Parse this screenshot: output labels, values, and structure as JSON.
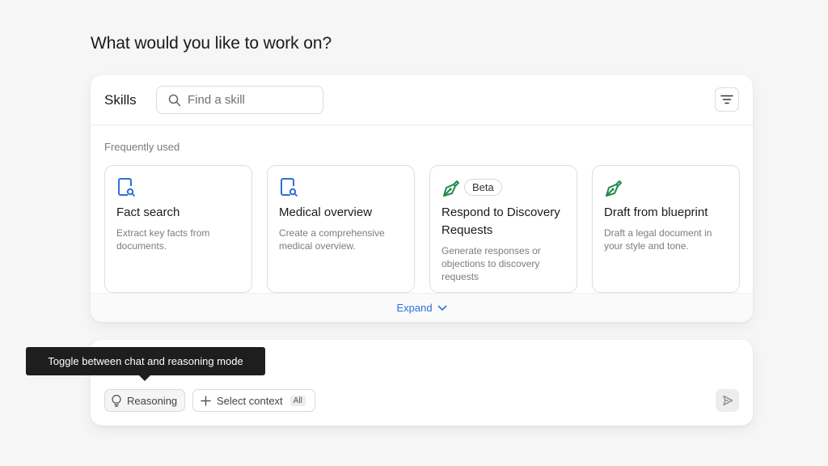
{
  "page": {
    "title": "What would you like to work on?"
  },
  "skills": {
    "title": "Skills",
    "search_placeholder": "Find a skill",
    "section_label": "Frequently used",
    "cards": [
      {
        "title": "Fact search",
        "description": "Extract key facts from documents.",
        "icon": "document-search-icon",
        "badge": ""
      },
      {
        "title": "Medical overview",
        "description": "Create a comprehensive medical overview.",
        "icon": "document-search-icon",
        "badge": ""
      },
      {
        "title": "Respond to Discovery Requests",
        "description": "Generate responses or objections to discovery requests",
        "icon": "pen-nib-icon",
        "badge": "Beta"
      },
      {
        "title": "Draft from blueprint",
        "description": "Draft a legal document in your style and tone.",
        "icon": "pen-nib-icon",
        "badge": ""
      }
    ],
    "expand_label": "Expand"
  },
  "chat": {
    "reasoning_label": "Reasoning",
    "context_label": "Select context",
    "context_scope": "All"
  },
  "tooltip": {
    "text": "Toggle between chat and reasoning mode"
  },
  "colors": {
    "accent_blue": "#2f6fde",
    "accent_green": "#1f8a4c",
    "tooltip_bg": "#1e1e1e"
  }
}
